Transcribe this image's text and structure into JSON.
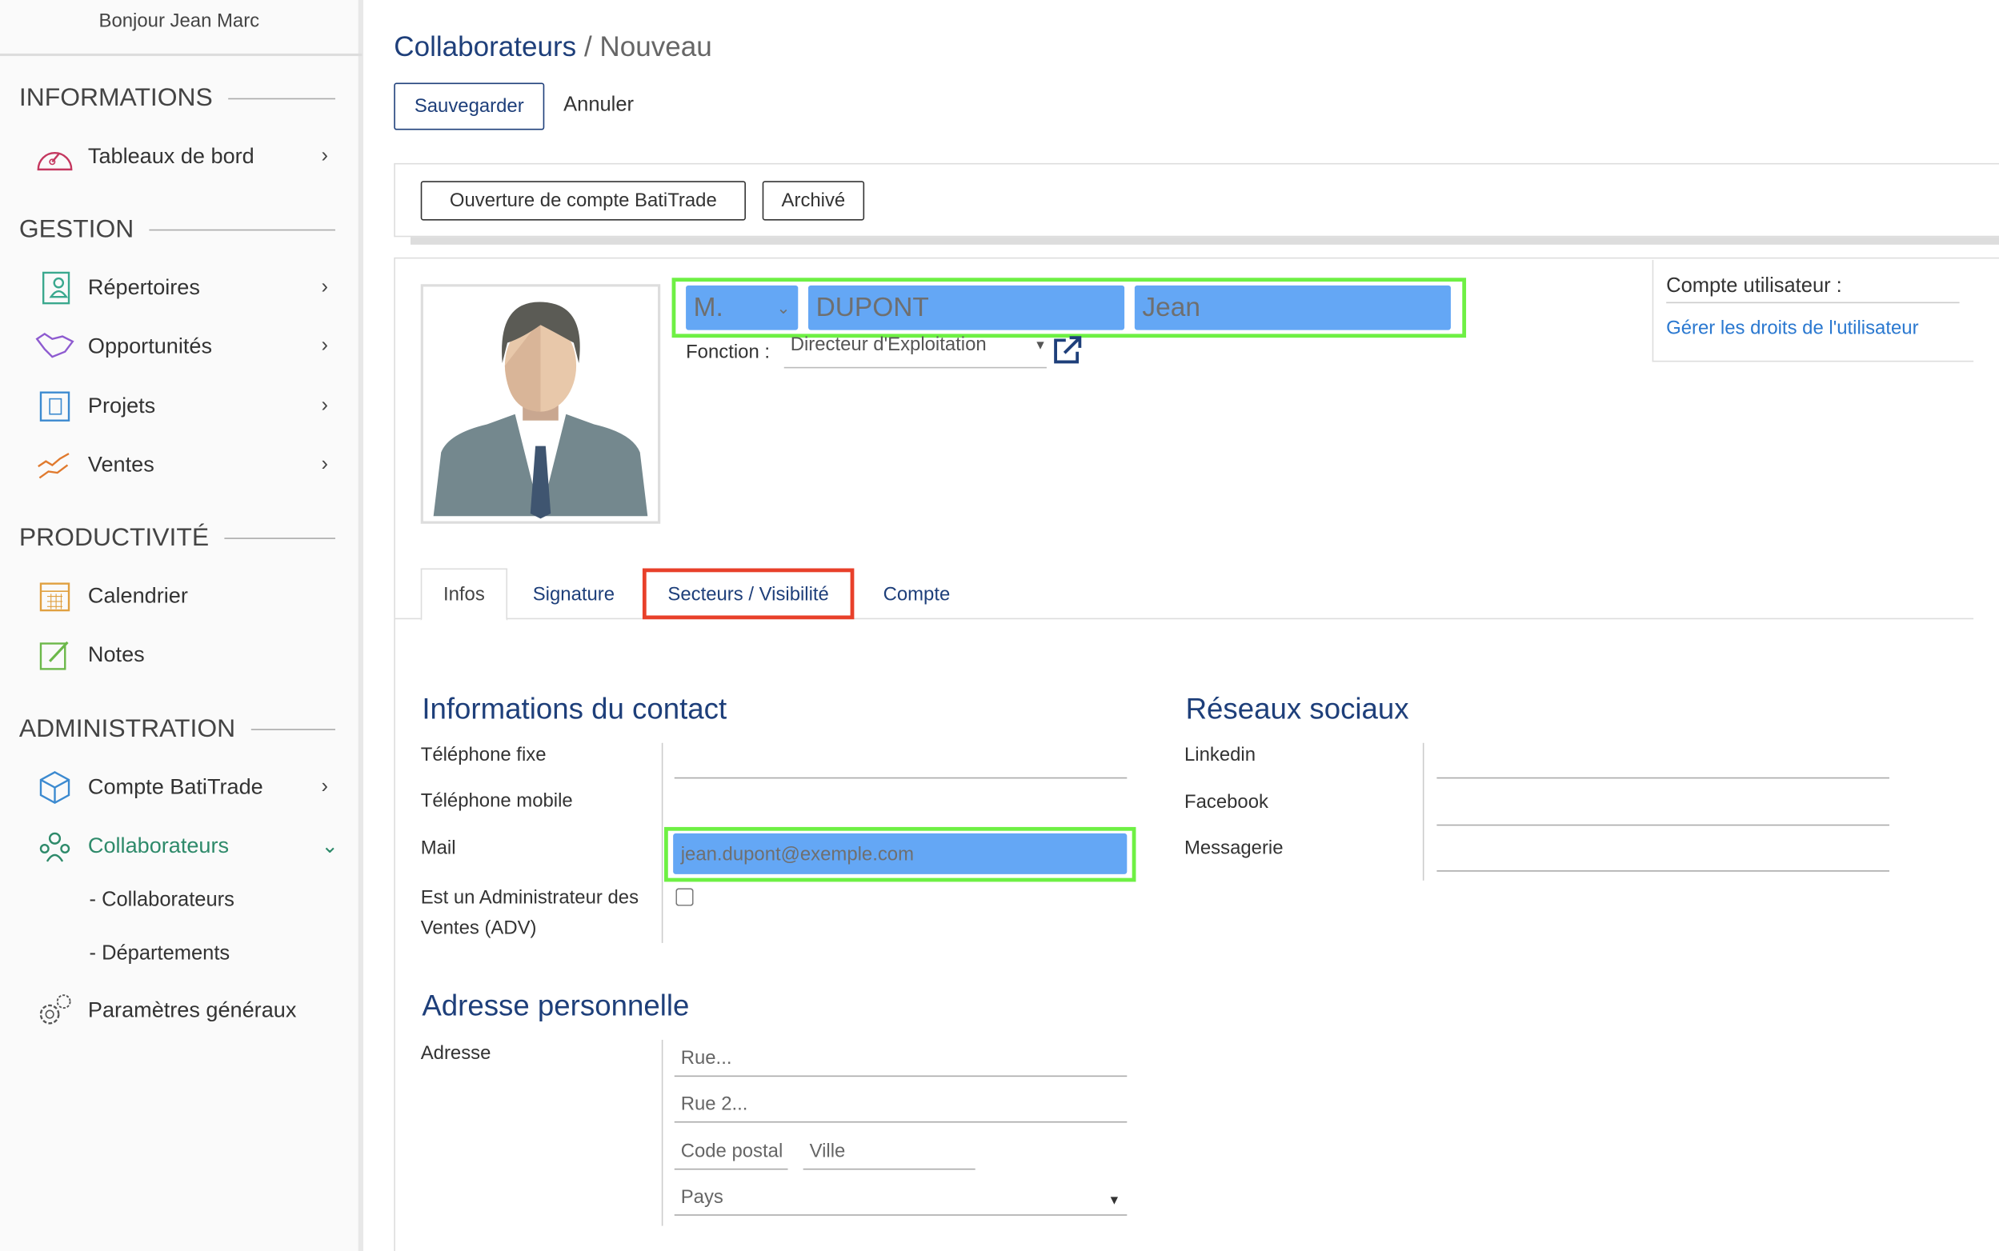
{
  "sidebar": {
    "greeting": "Bonjour Jean Marc",
    "sections": [
      {
        "title": "INFORMATIONS",
        "items": [
          {
            "label": "Tableaux de bord",
            "icon": "dashboard-gauge-icon",
            "color": "#c4375f"
          }
        ]
      },
      {
        "title": "GESTION",
        "items": [
          {
            "label": "Répertoires",
            "icon": "contact-book-icon",
            "color": "#3aa88e"
          },
          {
            "label": "Opportunités",
            "icon": "handshake-icon",
            "color": "#8e5bd0"
          },
          {
            "label": "Projets",
            "icon": "blueprint-icon",
            "color": "#3c8ad0"
          },
          {
            "label": "Ventes",
            "icon": "sales-chart-icon",
            "color": "#e07a2e"
          }
        ]
      },
      {
        "title": "PRODUCTIVITÉ",
        "items": [
          {
            "label": "Calendrier",
            "icon": "calendar-icon",
            "color": "#e0a040"
          },
          {
            "label": "Notes",
            "icon": "note-pencil-icon",
            "color": "#6cb84a"
          }
        ]
      },
      {
        "title": "ADMINISTRATION",
        "items": [
          {
            "label": "Compte BatiTrade",
            "icon": "cube-icon",
            "color": "#3c8ad0"
          },
          {
            "label": "Collaborateurs",
            "icon": "team-icon",
            "color": "#2e8a6a"
          },
          {
            "label": "Paramètres généraux",
            "icon": "gears-icon",
            "color": "#555"
          }
        ]
      }
    ],
    "subitems": [
      "- Collaborateurs",
      "- Départements"
    ],
    "active_color": "#2e8a6a"
  },
  "header": {
    "breadcrumb_root": "Collaborateurs",
    "breadcrumb_sep": " / ",
    "breadcrumb_current": "Nouveau",
    "save": "Sauvegarder",
    "cancel": "Annuler"
  },
  "actions": {
    "open_account": "Ouverture de compte BatiTrade",
    "archived": "Archivé"
  },
  "identity": {
    "civility": "M.",
    "last_name": "DUPONT",
    "first_name": "Jean",
    "function_label": "Fonction :",
    "function_value": "Directeur d'Exploitation"
  },
  "user_account": {
    "title": "Compte utilisateur :",
    "link": "Gérer les droits de l'utilisateur"
  },
  "tabs": [
    "Infos",
    "Signature",
    "Secteurs / Visibilité",
    "Compte"
  ],
  "contact": {
    "title": "Informations du contact",
    "fields": [
      {
        "label": "Téléphone fixe",
        "value": ""
      },
      {
        "label": "Téléphone mobile",
        "value": ""
      },
      {
        "label": "Mail",
        "value": "jean.dupont@exemple.com"
      }
    ],
    "adv_label": "Est un Administrateur des Ventes (ADV)",
    "adv_checked": false
  },
  "social": {
    "title": "Réseaux sociaux",
    "fields": [
      {
        "label": "Linkedin",
        "value": ""
      },
      {
        "label": "Facebook",
        "value": ""
      },
      {
        "label": "Messagerie",
        "value": ""
      }
    ]
  },
  "address": {
    "title": "Adresse personnelle",
    "label": "Adresse",
    "street_placeholder": "Rue...",
    "street2_placeholder": "Rue 2...",
    "zip_placeholder": "Code postal",
    "city_placeholder": "Ville",
    "country_placeholder": "Pays"
  },
  "colors": {
    "primary": "#1e3f7a",
    "highlight_fill": "#64a7f5",
    "highlight_green": "#6ef044",
    "highlight_red": "#e8402a",
    "link": "#2a78d0"
  }
}
